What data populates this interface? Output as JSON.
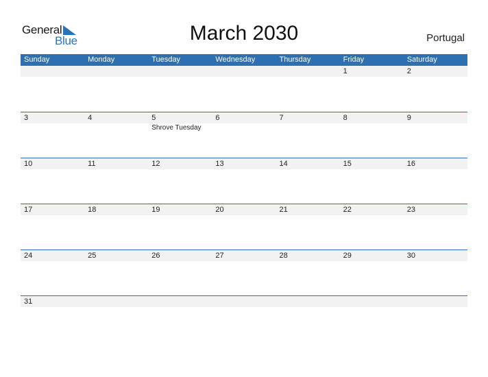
{
  "logo": {
    "line1": "General",
    "line2": "Blue",
    "accent": "#2a73b8"
  },
  "title": "March 2030",
  "country": "Portugal",
  "colors": {
    "header_bg": "#2e6fb1",
    "date_bg": "#f2f2f2"
  },
  "weekdays": [
    "Sunday",
    "Monday",
    "Tuesday",
    "Wednesday",
    "Thursday",
    "Friday",
    "Saturday"
  ],
  "weeks": [
    [
      {
        "d": ""
      },
      {
        "d": ""
      },
      {
        "d": ""
      },
      {
        "d": ""
      },
      {
        "d": ""
      },
      {
        "d": "1"
      },
      {
        "d": "2"
      }
    ],
    [
      {
        "d": "3"
      },
      {
        "d": "4"
      },
      {
        "d": "5",
        "event": "Shrove Tuesday"
      },
      {
        "d": "6"
      },
      {
        "d": "7"
      },
      {
        "d": "8"
      },
      {
        "d": "9"
      }
    ],
    [
      {
        "d": "10"
      },
      {
        "d": "11"
      },
      {
        "d": "12"
      },
      {
        "d": "13"
      },
      {
        "d": "14"
      },
      {
        "d": "15"
      },
      {
        "d": "16"
      }
    ],
    [
      {
        "d": "17"
      },
      {
        "d": "18"
      },
      {
        "d": "19"
      },
      {
        "d": "20"
      },
      {
        "d": "21"
      },
      {
        "d": "22"
      },
      {
        "d": "23"
      }
    ],
    [
      {
        "d": "24"
      },
      {
        "d": "25"
      },
      {
        "d": "26"
      },
      {
        "d": "27"
      },
      {
        "d": "28"
      },
      {
        "d": "29"
      },
      {
        "d": "30"
      }
    ],
    [
      {
        "d": "31"
      },
      {
        "d": ""
      },
      {
        "d": ""
      },
      {
        "d": ""
      },
      {
        "d": ""
      },
      {
        "d": ""
      },
      {
        "d": ""
      }
    ]
  ]
}
